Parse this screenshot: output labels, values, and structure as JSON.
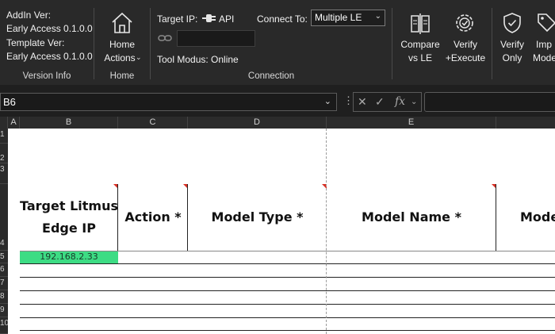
{
  "ribbon": {
    "version_info": {
      "addin_label": "AddIn Ver:",
      "addin_value": "Early Access 0.1.0.0",
      "template_label": "Template Ver:",
      "template_value": "Early Access 0.1.0.0",
      "group_label": "Version Info"
    },
    "home": {
      "button_line1": "Home",
      "button_line2": "Actions",
      "group_label": "Home"
    },
    "connection": {
      "target_ip_label": "Target IP:",
      "api_label": "API",
      "connect_to_label": "Connect To:",
      "connect_to_value": "Multiple LE",
      "tool_modus": "Tool Modus: Online",
      "group_label": "Connection"
    },
    "actions": {
      "compare_line1": "Compare",
      "compare_line2": "vs LE",
      "verify_exec_line1": "Verify",
      "verify_exec_line2": "+Execute",
      "verify_only_line1": "Verify",
      "verify_only_line2": "Only",
      "import_line1": "Imp",
      "import_line2": "Mode"
    }
  },
  "formula_bar": {
    "name_box": "B6",
    "fx": "fx"
  },
  "sheet": {
    "columns": [
      "A",
      "B",
      "C",
      "D",
      "E"
    ],
    "rows": [
      "1",
      "2",
      "3",
      "4",
      "5",
      "6",
      "7",
      "8",
      "9",
      "10"
    ],
    "headers": {
      "b": [
        "Target Litmus",
        "Edge IP"
      ],
      "c": "Action *",
      "d": "Model Type *",
      "e": "Model Name *",
      "f": "Mode"
    },
    "cell_b6": "192.168.2.33"
  },
  "colors": {
    "ribbon_bg": "#292929",
    "selected_cell": "#3ddc84",
    "comment_marker": "#d93025"
  }
}
